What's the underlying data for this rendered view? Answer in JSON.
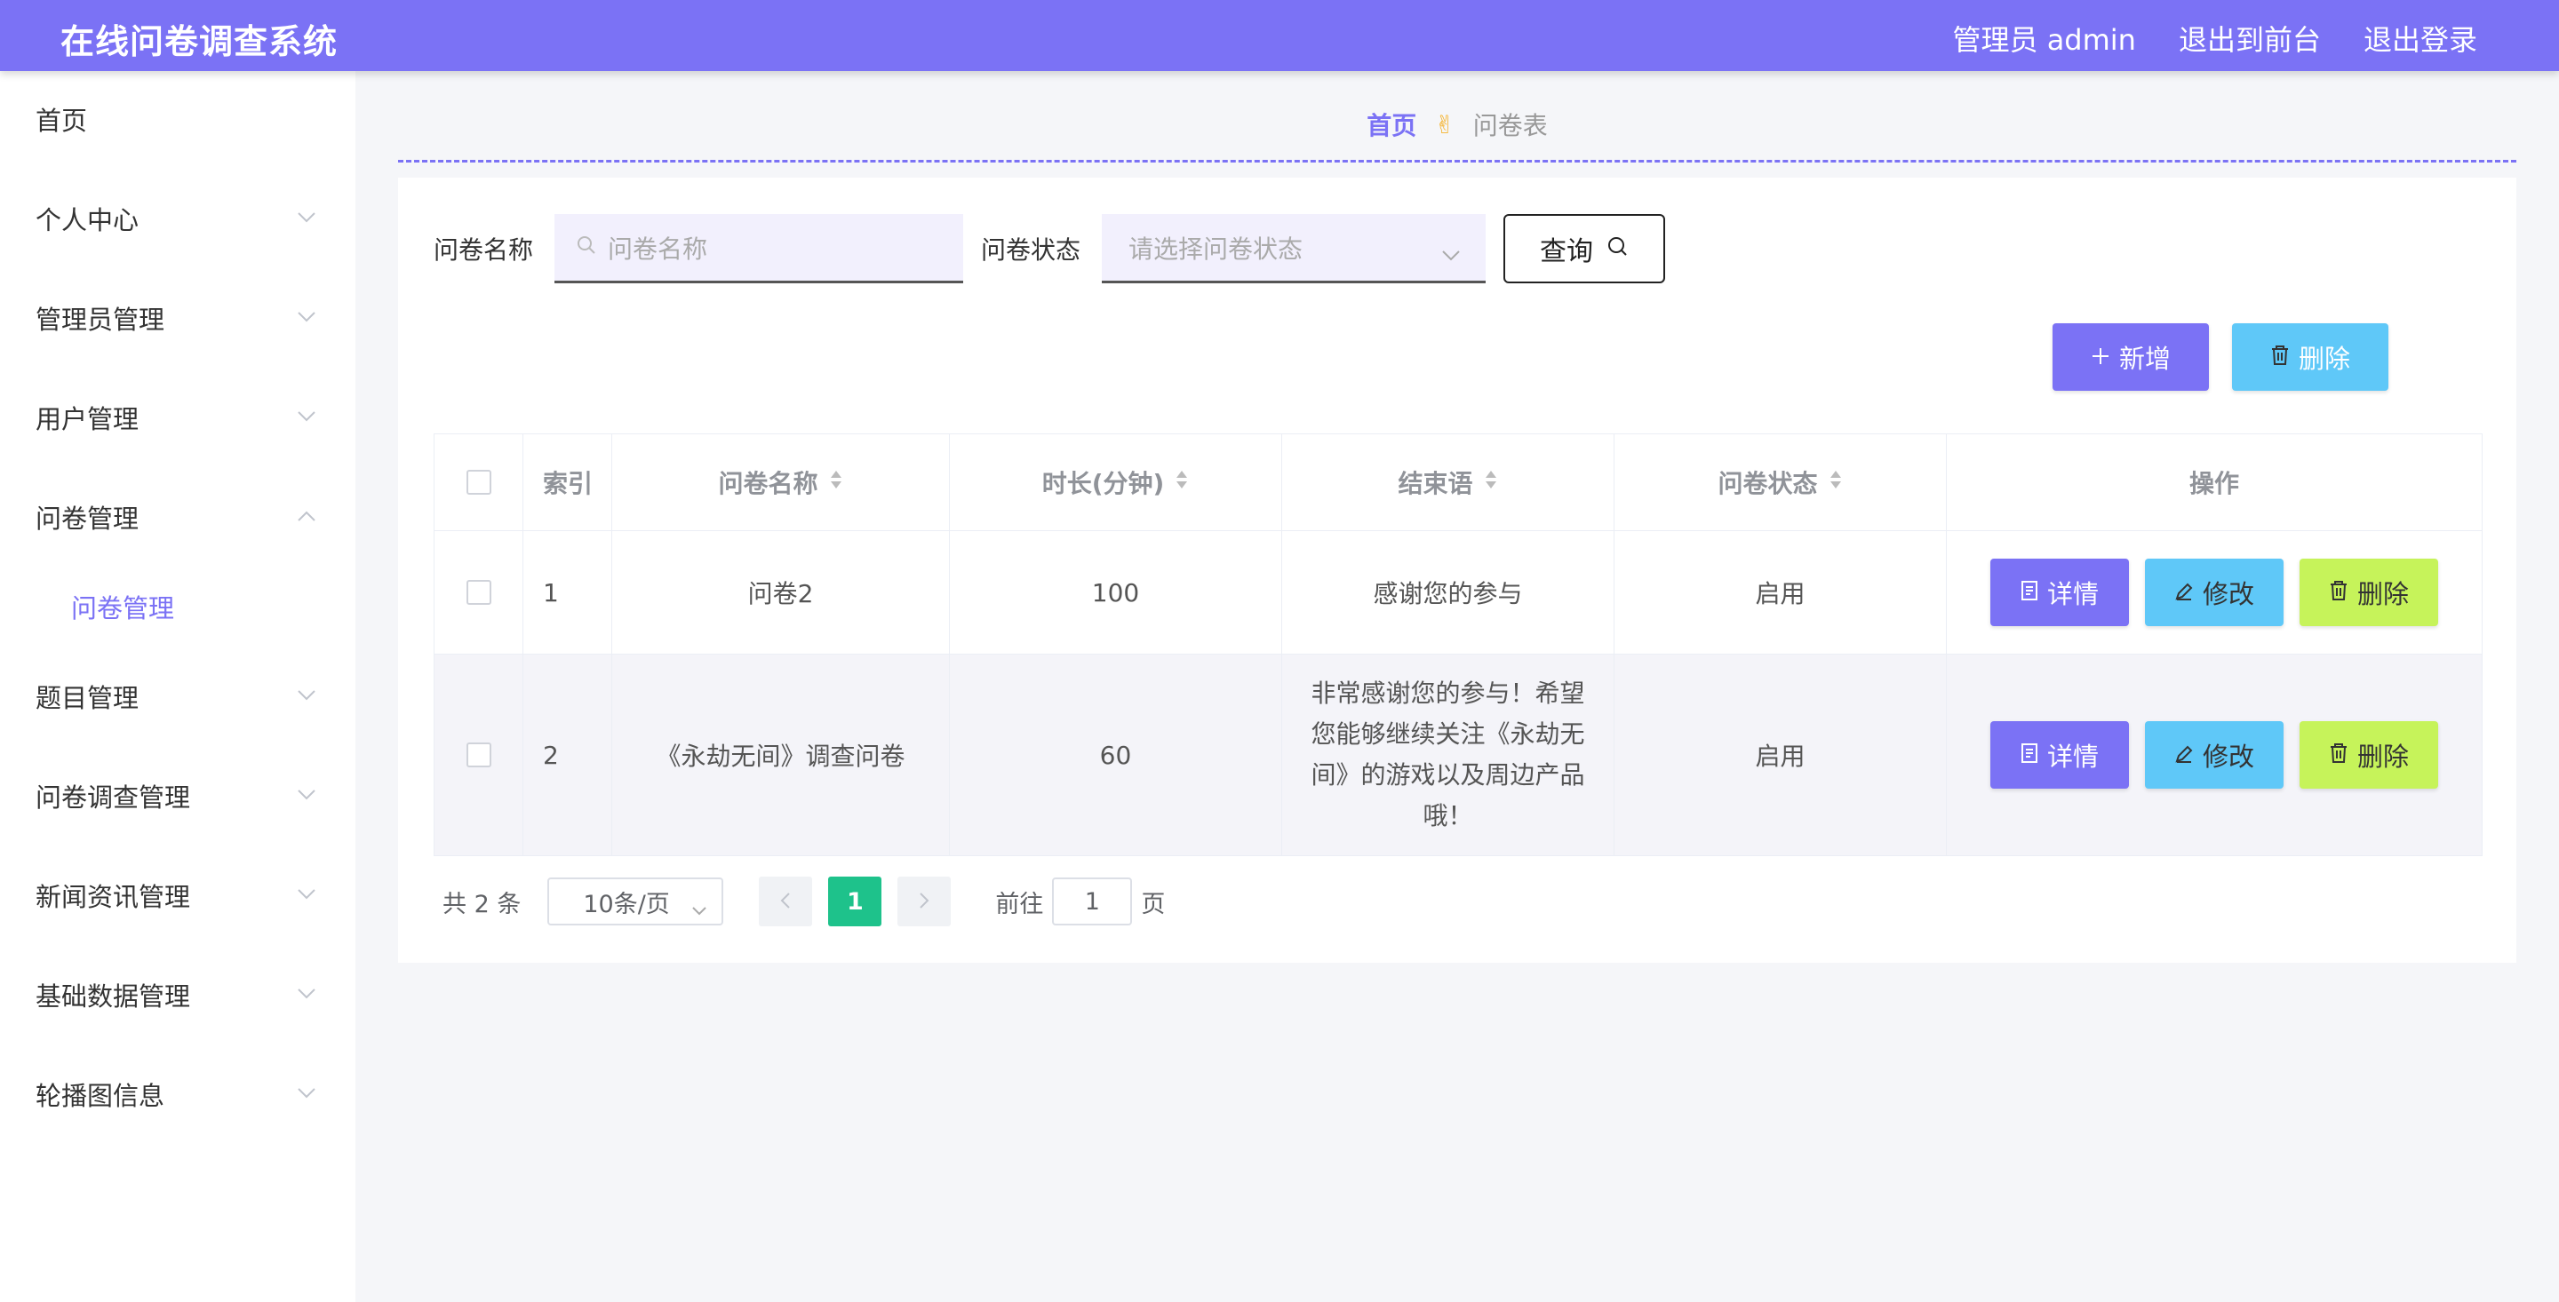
{
  "header": {
    "app_title": "在线问卷调查系统",
    "nav": [
      "管理员 admin",
      "退出到前台",
      "退出登录"
    ]
  },
  "sidebar": {
    "items": [
      {
        "label": "首页",
        "has_chevron": false
      },
      {
        "label": "个人中心",
        "has_chevron": true
      },
      {
        "label": "管理员管理",
        "has_chevron": true
      },
      {
        "label": "用户管理",
        "has_chevron": true
      },
      {
        "label": "问卷管理",
        "has_chevron": true,
        "expanded": true
      },
      {
        "label": "题目管理",
        "has_chevron": true
      },
      {
        "label": "问卷调查管理",
        "has_chevron": true
      },
      {
        "label": "新闻资讯管理",
        "has_chevron": true
      },
      {
        "label": "基础数据管理",
        "has_chevron": true
      },
      {
        "label": "轮播图信息",
        "has_chevron": true
      }
    ],
    "sub_item": "问卷管理"
  },
  "breadcrumb": {
    "home": "首页",
    "separator": "✌",
    "current": "问卷表"
  },
  "search": {
    "name_label": "问卷名称",
    "name_placeholder": "问卷名称",
    "status_label": "问卷状态",
    "status_placeholder": "请选择问卷状态",
    "query_label": "查询"
  },
  "toolbar": {
    "add_label": "新增",
    "delete_label": "删除"
  },
  "table": {
    "headers": [
      "索引",
      "问卷名称",
      "时长(分钟)",
      "结束语",
      "问卷状态",
      "操作"
    ],
    "rows": [
      {
        "index": "1",
        "name": "问卷2",
        "duration": "100",
        "ending": "感谢您的参与",
        "status": "启用"
      },
      {
        "index": "2",
        "name": "《永劫无间》调查问卷",
        "duration": "60",
        "ending": "非常感谢您的参与！希望您能够继续关注《永劫无间》的游戏以及周边产品哦！",
        "status": "启用"
      }
    ],
    "actions": {
      "detail": "详情",
      "edit": "修改",
      "delete": "删除"
    }
  },
  "pagination": {
    "total": "共 2 条",
    "page_size": "10条/页",
    "current_page": "1",
    "goto_prefix": "前往",
    "goto_value": "1",
    "goto_suffix": "页"
  },
  "colors": {
    "primary": "#7b72f5",
    "info": "#5fc8f8",
    "lime": "#c6f35a",
    "pager_active": "#1ec28b"
  }
}
